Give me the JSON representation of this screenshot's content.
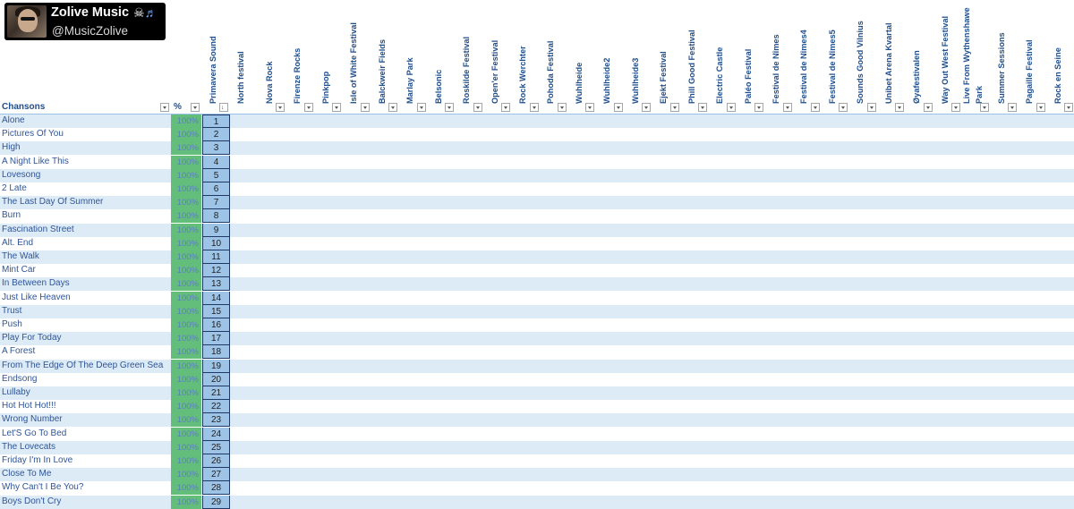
{
  "badge": {
    "title": "Zolive Music",
    "handle": "@MusicZolive",
    "icons": [
      "skull-crossbones-icon",
      "music-notes-icon"
    ]
  },
  "columns": {
    "song_header": "Chansons",
    "pct_header": "%",
    "festivals": [
      "Primavera Sound",
      "North festival",
      "Nova Rock",
      "Firenze Rocks",
      "Pinkpop",
      "Isle of White Festival",
      "Balckweir Fields",
      "Marlay Park",
      "Belsonic",
      "Roskilde Festival",
      "Open'er Festival",
      "Rock Werchter",
      "Pohoda Festival",
      "Wuhlheide",
      "Wuhlheide2",
      "Wuhlheide3",
      "Ejekt Festival",
      "Phill Good Festival",
      "Electric Castle",
      "Paléo Festival",
      "Festival de Nîmes",
      "Festival de Nîmes4",
      "Festival de Nîmes5",
      "Sounds Good Vilnius",
      "Unibet Arena Kvartal",
      "Øyafestivalen",
      "Way Out West Festival",
      "Live From Wythenshawe Park",
      "Summer Sessions",
      "Pagaille Festival",
      "Rock en Seine"
    ]
  },
  "rows": [
    {
      "song": "Alone",
      "pct": "100%",
      "rank": "1"
    },
    {
      "song": "Pictures Of You",
      "pct": "100%",
      "rank": "2"
    },
    {
      "song": "High",
      "pct": "100%",
      "rank": "3"
    },
    {
      "song": "A Night Like This",
      "pct": "100%",
      "rank": "4"
    },
    {
      "song": "Lovesong",
      "pct": "100%",
      "rank": "5"
    },
    {
      "song": "2 Late",
      "pct": "100%",
      "rank": "6"
    },
    {
      "song": "The Last Day Of Summer",
      "pct": "100%",
      "rank": "7"
    },
    {
      "song": "Burn",
      "pct": "100%",
      "rank": "8"
    },
    {
      "song": "Fascination Street",
      "pct": "100%",
      "rank": "9"
    },
    {
      "song": "Alt. End",
      "pct": "100%",
      "rank": "10"
    },
    {
      "song": "The Walk",
      "pct": "100%",
      "rank": "11"
    },
    {
      "song": "Mint Car",
      "pct": "100%",
      "rank": "12"
    },
    {
      "song": "In Between Days",
      "pct": "100%",
      "rank": "13"
    },
    {
      "song": "Just Like Heaven",
      "pct": "100%",
      "rank": "14"
    },
    {
      "song": "Trust",
      "pct": "100%",
      "rank": "15"
    },
    {
      "song": "Push",
      "pct": "100%",
      "rank": "16"
    },
    {
      "song": "Play For Today",
      "pct": "100%",
      "rank": "17"
    },
    {
      "song": "A Forest",
      "pct": "100%",
      "rank": "18"
    },
    {
      "song": "From The Edge Of The Deep Green Sea",
      "pct": "100%",
      "rank": "19"
    },
    {
      "song": "Endsong",
      "pct": "100%",
      "rank": "20"
    },
    {
      "song": "Lullaby",
      "pct": "100%",
      "rank": "21"
    },
    {
      "song": "Hot Hot Hot!!!",
      "pct": "100%",
      "rank": "22"
    },
    {
      "song": "Wrong Number",
      "pct": "100%",
      "rank": "23"
    },
    {
      "song": "Let'S Go To Bed",
      "pct": "100%",
      "rank": "24"
    },
    {
      "song": "The Lovecats",
      "pct": "100%",
      "rank": "25"
    },
    {
      "song": "Friday I'm In Love",
      "pct": "100%",
      "rank": "26"
    },
    {
      "song": "Close To Me",
      "pct": "100%",
      "rank": "27"
    },
    {
      "song": "Why Can't I Be You?",
      "pct": "100%",
      "rank": "28"
    },
    {
      "song": "Boys Don't Cry",
      "pct": "100%",
      "rank": "29"
    }
  ]
}
